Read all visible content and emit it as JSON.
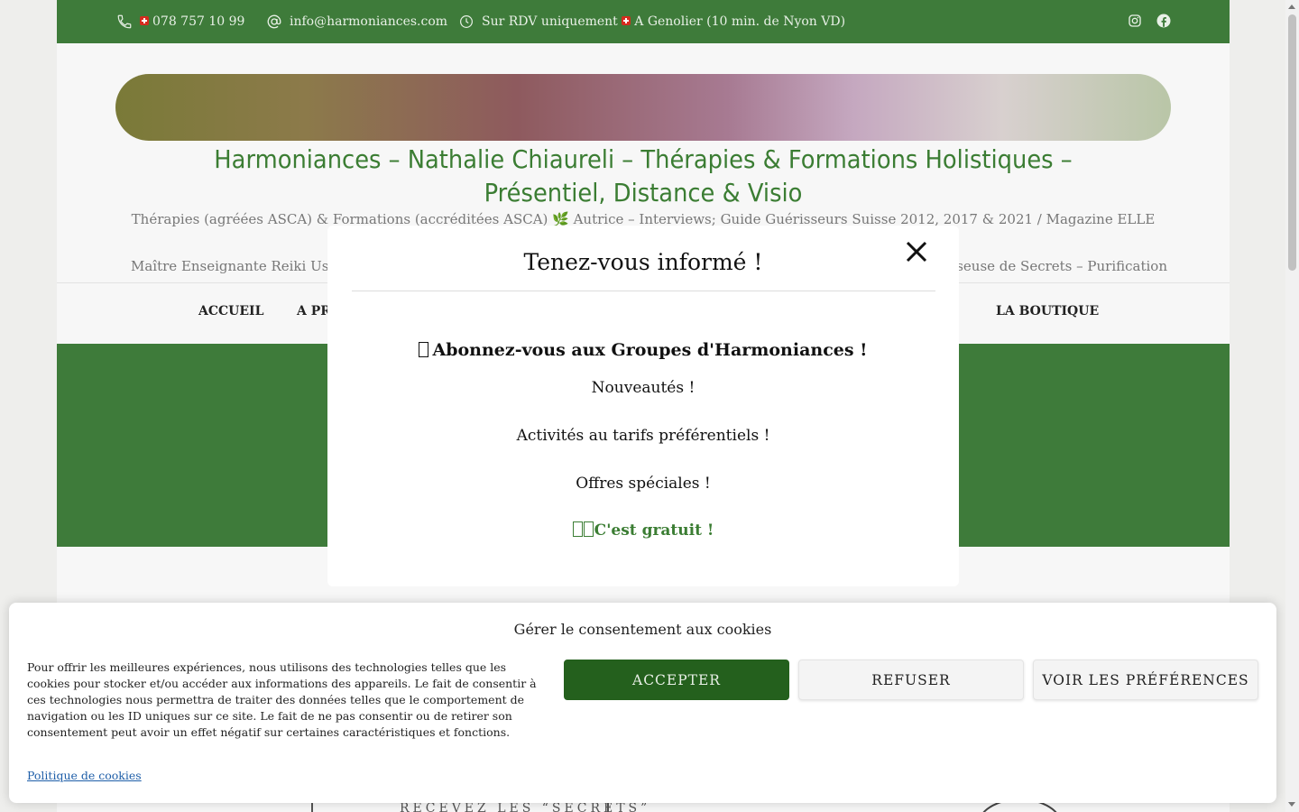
{
  "topbar": {
    "phone": "078 757 10 99",
    "email": "info@harmoniances.com",
    "hours_prefix": "Sur RDV uniquement",
    "location": "A Genolier (10 min. de Nyon VD)",
    "icons": [
      "phone-icon",
      "at-icon",
      "clock-icon",
      "instagram-icon",
      "facebook-icon"
    ]
  },
  "header": {
    "site_title": "Harmoniances – Nathalie Chiaureli – Thérapies & Formations Holistiques – Présentiel, Distance & Visio",
    "desc_line1": "Thérapies (agréées ASCA) & Formations (accréditées ASCA) 🌿 Autrice – Interviews; Guide Guérisseurs Suisse 2012, 2017 & 2021 / Magazine ELLE 2022 –",
    "desc_line2": "Maître Enseignante Reiki Usui",
    "desc_line2_end": "iseuse de Secrets – Purification"
  },
  "nav": {
    "items": [
      "ACCUEIL",
      "A PR",
      "LA BOUTIQUE"
    ]
  },
  "peek": {
    "text": "RECEVEZ LES “SECRETS”"
  },
  "modal": {
    "title": "Tenez-vous informé !",
    "heading": "Abonnez-vous aux Groupes d'Harmoniances !",
    "line1": "Nouveautés !",
    "line2": "Activités au tarifs préférentiels !",
    "line3": "Offres spéciales !",
    "free": "C'est gratuit !"
  },
  "cookie": {
    "title": "Gérer le consentement aux cookies",
    "text": "Pour offrir les meilleures expériences, nous utilisons des technologies telles que les cookies pour stocker et/ou accéder aux informations des appareils. Le fait de consentir à ces technologies nous permettra de traiter des données telles que le comportement de navigation ou les ID uniques sur ce site. Le fait de ne pas consentir ou de retirer son consentement peut avoir un effet négatif sur certaines caractéristiques et fonctions.",
    "accept": "ACCEPTER",
    "refuse": "REFUSER",
    "prefs": "VOIR LES PRÉFÉRENCES",
    "policy_link": "Politique de cookies"
  },
  "colors": {
    "brand_green": "#3e7b3a",
    "accept_green": "#24601d",
    "title_green": "#3b7d33"
  }
}
